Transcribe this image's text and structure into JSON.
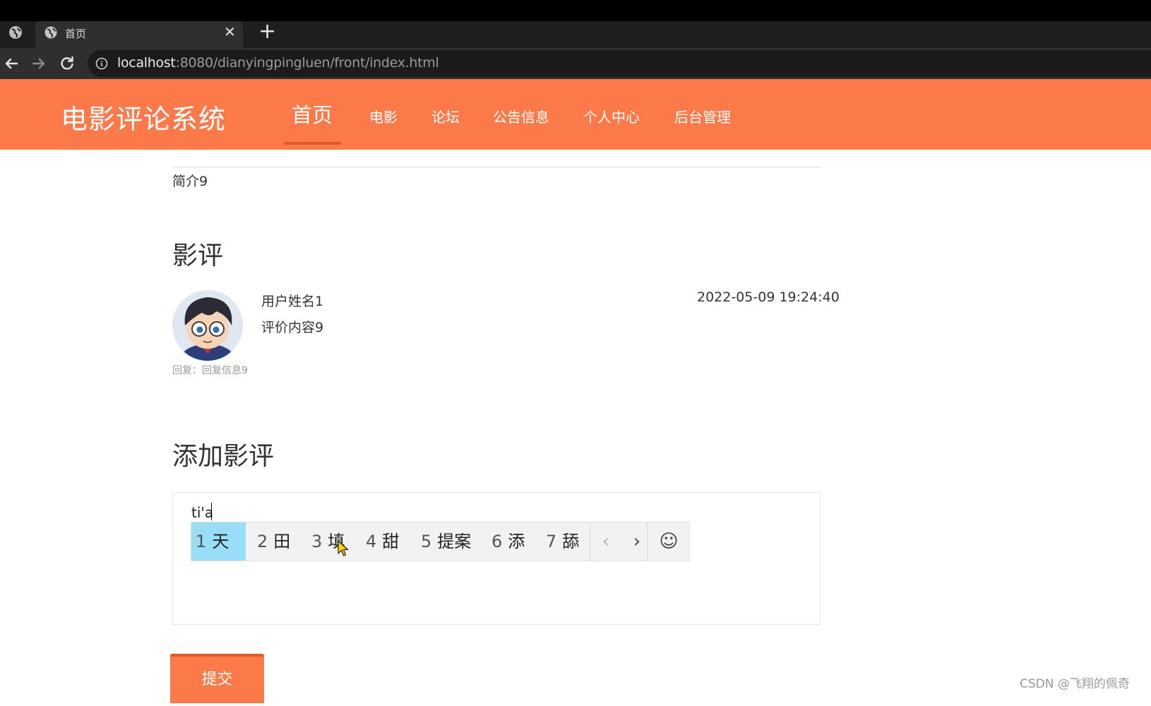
{
  "browser": {
    "tab": {
      "title": "首页",
      "close_glyph": "✕"
    },
    "new_tab_glyph": "+",
    "url": {
      "host": "localhost",
      "rest": ":8080/dianyingpingluen/front/index.html"
    }
  },
  "site": {
    "title": "电影评论系统",
    "nav": [
      {
        "label": "首页",
        "active": true
      },
      {
        "label": "电影"
      },
      {
        "label": "论坛"
      },
      {
        "label": "公告信息"
      },
      {
        "label": "个人中心"
      },
      {
        "label": "后台管理"
      }
    ],
    "accent_color": "#fc7a4a"
  },
  "content": {
    "intro": "简介9",
    "reviews_title": "影评",
    "review": {
      "user": "用户姓名1",
      "text": "评价内容9",
      "time": "2022-05-09 19:24:40",
      "reply": "回复：回复信息9"
    },
    "add_review_title": "添加影评",
    "editor_value": "ti'a",
    "submit_label": "提交"
  },
  "ime": {
    "candidates": [
      {
        "num": "1",
        "text": "天",
        "selected": true
      },
      {
        "num": "2",
        "text": "田"
      },
      {
        "num": "3",
        "text": "填"
      },
      {
        "num": "4",
        "text": "甜"
      },
      {
        "num": "5",
        "text": "提案"
      },
      {
        "num": "6",
        "text": "添"
      },
      {
        "num": "7",
        "text": "舔"
      }
    ],
    "prev_glyph": "‹",
    "next_glyph": "›",
    "emoji_glyph": "☺"
  },
  "watermark": "CSDN @飞翔的佩奇"
}
